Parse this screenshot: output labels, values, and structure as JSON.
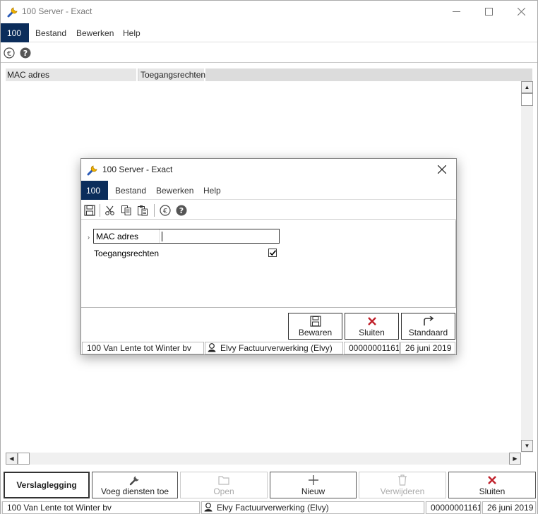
{
  "window": {
    "title": "100 Server - Exact",
    "menu": {
      "badge": "100",
      "items": [
        "Bestand",
        "Bewerken",
        "Help"
      ]
    },
    "grid": {
      "columns": [
        "MAC adres",
        "Toegangsrechten"
      ]
    },
    "buttons": [
      {
        "label": "Verslaglegging",
        "icon": "",
        "enabled": true
      },
      {
        "label": "Voeg diensten toe",
        "icon": "wrench-icon",
        "enabled": true
      },
      {
        "label": "Open",
        "icon": "folder-icon",
        "enabled": false
      },
      {
        "label": "Nieuw",
        "icon": "plus-icon",
        "enabled": true
      },
      {
        "label": "Verwijderen",
        "icon": "trash-icon",
        "enabled": false
      },
      {
        "label": "Sluiten",
        "icon": "close-x-icon",
        "enabled": true
      }
    ],
    "status": {
      "company": "100 Van Lente tot Winter bv",
      "user": "Elvy Factuurverwerking (Elvy)",
      "number": "00000001161",
      "date": "26 juni 2019"
    }
  },
  "dialog": {
    "title": "100 Server - Exact",
    "menu": {
      "badge": "100",
      "items": [
        "Bestand",
        "Bewerken",
        "Help"
      ]
    },
    "form": {
      "mac_label": "MAC adres",
      "mac_value": "",
      "rights_label": "Toegangsrechten",
      "rights_checked": true
    },
    "buttons": [
      {
        "label": "Bewaren",
        "icon": "save-icon"
      },
      {
        "label": "Sluiten",
        "icon": "close-x-icon"
      },
      {
        "label": "Standaard",
        "icon": "redo-arrow-icon"
      }
    ],
    "status": {
      "company": "100 Van Lente tot Winter bv",
      "user": "Elvy Factuurverwerking (Elvy)",
      "number": "00000001161",
      "date": "26 juni 2019"
    }
  },
  "colors": {
    "accent": "#0b2d5b",
    "close_red": "#c0202a"
  }
}
